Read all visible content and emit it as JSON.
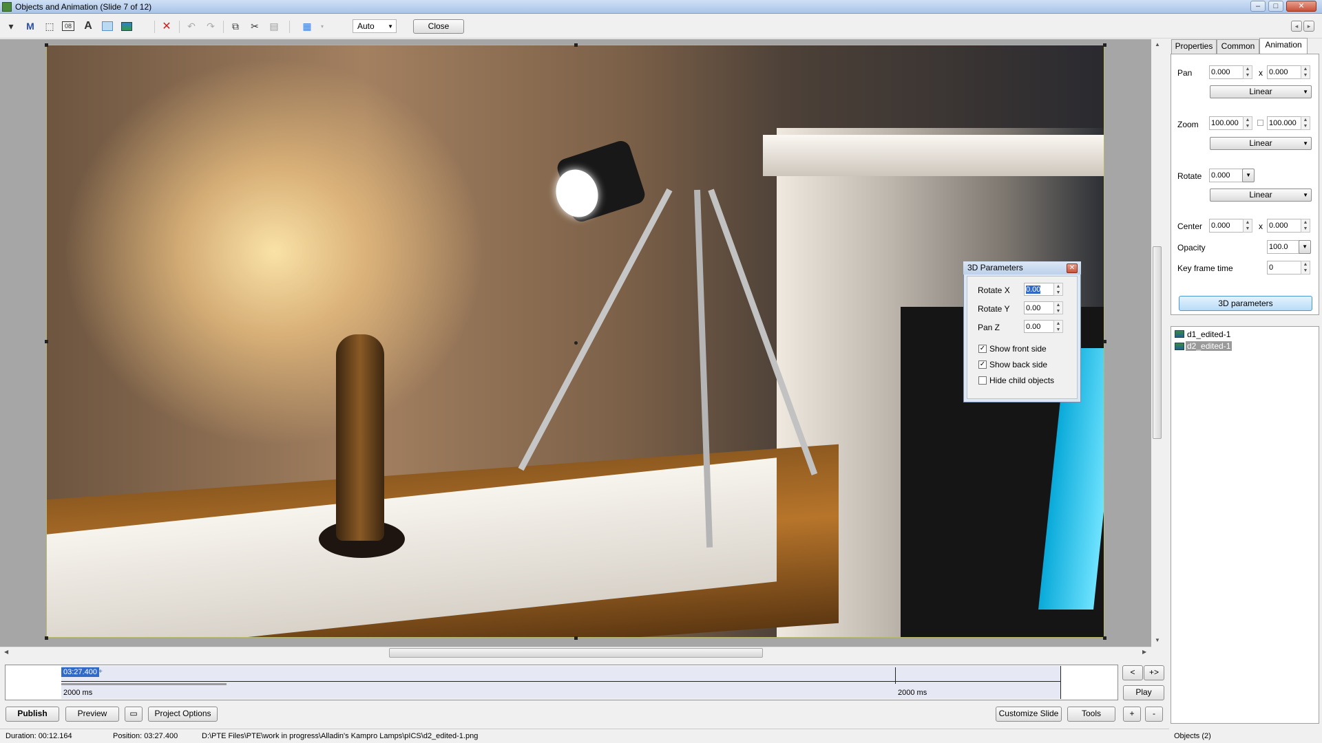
{
  "window": {
    "title": "Objects and Animation  (Slide 7 of 12)",
    "minimize": "–",
    "maximize": "□",
    "close": "✕"
  },
  "toolbar": {
    "icons": [
      "projector-icon",
      "m-icon",
      "frame-icon",
      "counter-icon",
      "text-icon",
      "rectangle-icon",
      "image-icon",
      "delete-icon",
      "undo-icon",
      "redo-icon",
      "copy-icon",
      "cut-icon",
      "paste-icon",
      "grid-icon"
    ],
    "zoom_value": "Auto",
    "close_label": "Close",
    "nav_prev": "◂",
    "nav_next": "▸"
  },
  "timeline": {
    "position": "03:27.400",
    "plus": "+",
    "duration_left": "2000 ms",
    "duration_right": "2000 ms",
    "prev_label": "<",
    "fit_label": "+>",
    "play_label": "Play"
  },
  "bottom_buttons": {
    "publish": "Publish",
    "preview": "Preview",
    "slideshow": "▭",
    "project_options": "Project Options",
    "customize_slide": "Customize Slide",
    "tools": "Tools",
    "zoom_in": "+",
    "zoom_out": "-"
  },
  "status": {
    "duration": "Duration:  00:12.164",
    "position": "Position:  03:27.400",
    "path": "D:\\PTE Files\\PTE\\work in progress\\Alladin's Kampro Lamps\\pICS\\d2_edited-1.png",
    "objects": "Objects (2)"
  },
  "tabs": [
    {
      "label": "Properties"
    },
    {
      "label": "Common"
    },
    {
      "label": "Animation"
    }
  ],
  "animation": {
    "pan_label": "Pan",
    "pan_x": "0.000",
    "pan_y": "0.000",
    "pan_mode": "Linear",
    "zoom_label": "Zoom",
    "zoom_x": "100.000",
    "zoom_y": "100.000",
    "zoom_mode": "Linear",
    "rotate_label": "Rotate",
    "rotate_value": "0.000",
    "rotate_mode": "Linear",
    "center_label": "Center",
    "center_x": "0.000",
    "center_y": "0.000",
    "opacity_label": "Opacity",
    "opacity_value": "100.0",
    "keyframe_label": "Key frame time",
    "keyframe_value": "0",
    "x_sep": "x",
    "params3d_label": "3D parameters"
  },
  "objects": [
    {
      "name": "d1_edited-1",
      "selected": false
    },
    {
      "name": "d2_edited-1",
      "selected": true
    }
  ],
  "dialog3d": {
    "title": "3D Parameters",
    "rotate_x_label": "Rotate X",
    "rotate_x": "0.00",
    "rotate_y_label": "Rotate Y",
    "rotate_y": "0.00",
    "pan_z_label": "Pan Z",
    "pan_z": "0.00",
    "show_front_label": "Show front side",
    "show_front": true,
    "show_back_label": "Show back side",
    "show_back": true,
    "hide_child_label": "Hide child objects",
    "hide_child": false
  },
  "colors": {
    "accent": "#3169c6",
    "selection_frame": "#b8b86a",
    "button_3d": "#b9dcf7"
  }
}
